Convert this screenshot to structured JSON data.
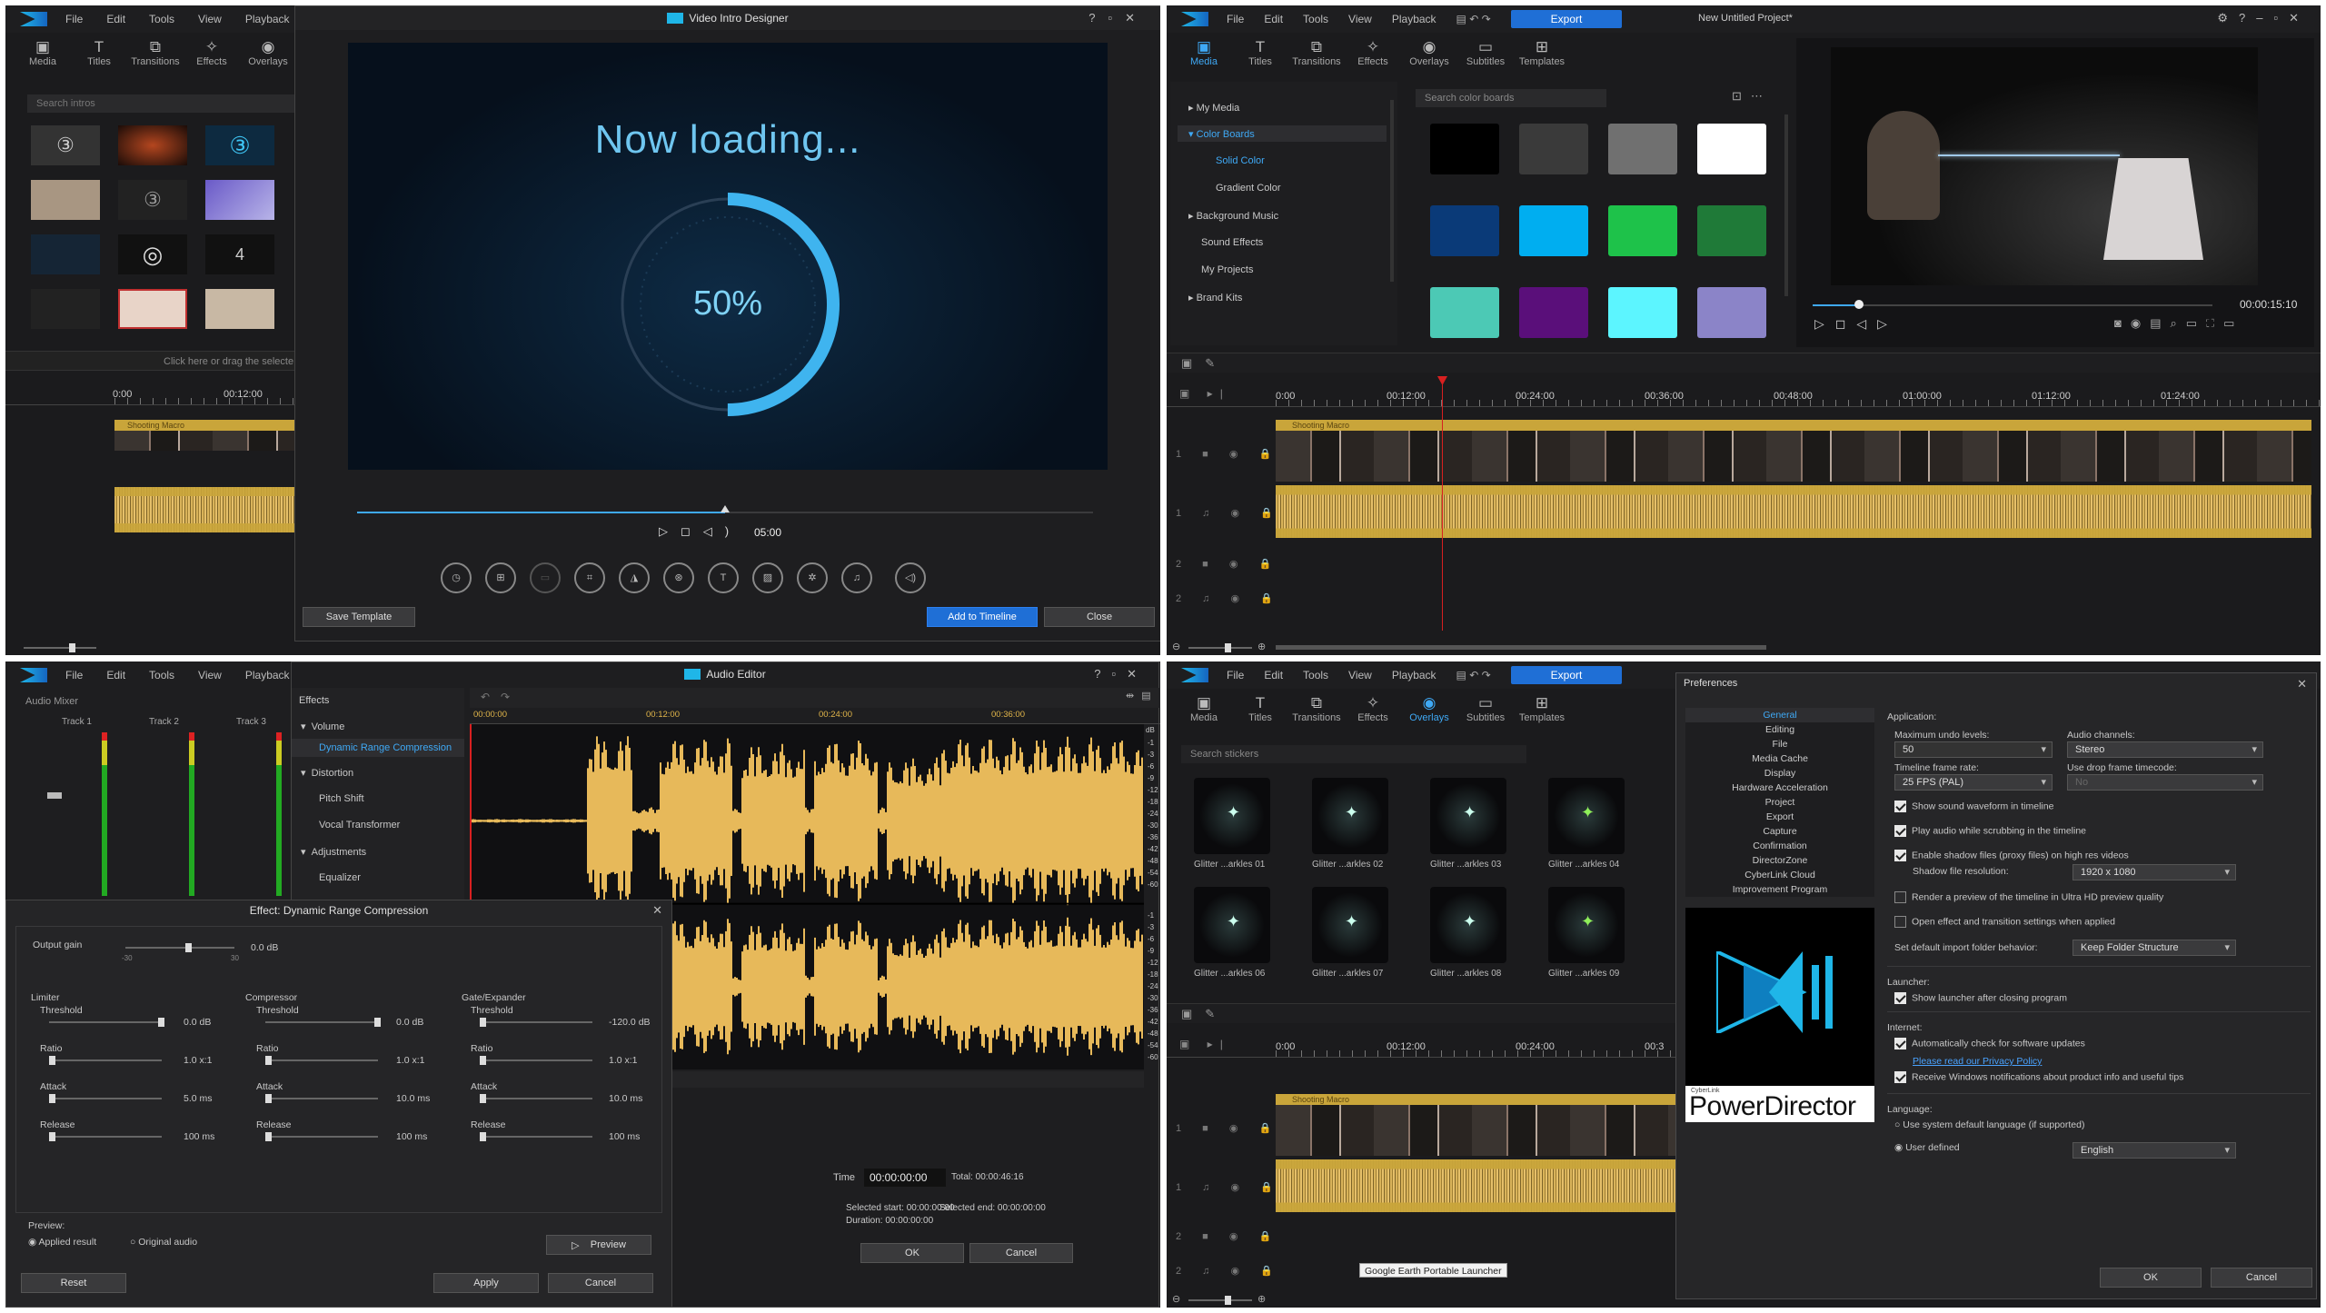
{
  "menu": {
    "file": "File",
    "edit": "Edit",
    "tools": "Tools",
    "view": "View",
    "playback": "Playback"
  },
  "toolbar": {
    "media": "Media",
    "titles": "Titles",
    "transitions": "Transitions",
    "effects": "Effects",
    "overlays": "Overlays",
    "subtitles": "Subtitles",
    "templates": "Templates"
  },
  "timeline": {
    "track_label": "Shooting Macro",
    "t0": "0:00",
    "t1": "00:12:00",
    "t2": "00:24:00",
    "t3": "00:36:00",
    "t4": "00:48:00",
    "t5": "01:00:00",
    "t6": "01:12:00",
    "t7": "01:24:00"
  },
  "q1": {
    "search_placeholder": "Search intros",
    "drop_hint": "Click here or drag the selecte",
    "dialog_title": "Video Intro Designer",
    "loading_text": "Now loading...",
    "progress_label": "50%",
    "progress_fraction": 0.5,
    "playback_fraction": 0.5,
    "time": "05:00",
    "save_template": "Save Template",
    "add_to_timeline": "Add to Timeline",
    "close": "Close"
  },
  "q2": {
    "export": "Export",
    "project_title": "New Untitled Project*",
    "search_placeholder": "Search color boards",
    "tree": {
      "my_media": "My Media",
      "color_boards": "Color Boards",
      "solid_color": "Solid Color",
      "gradient_color": "Gradient Color",
      "background_music": "Background Music",
      "sound_effects": "Sound Effects",
      "my_projects": "My Projects",
      "brand_kits": "Brand Kits"
    },
    "swatches": [
      "#000000",
      "#3a3a3a",
      "#707070",
      "#ffffff",
      "#0a3a78",
      "#00aef0",
      "#1ec24a",
      "#1f7a38",
      "#4cc9b5",
      "#5a0f7a",
      "#5cf5ff",
      "#8b84c8"
    ],
    "timecode": "00:00:15:10"
  },
  "q3": {
    "audio_mixer": "Audio Mixer",
    "tracks": [
      "Track 1",
      "Track 2",
      "Track 3"
    ],
    "dialog_title": "Audio Editor",
    "effects_header": "Effects",
    "volume": "Volume",
    "drc": "Dynamic Range Compression",
    "distortion": "Distortion",
    "pitch_shift": "Pitch Shift",
    "vocal_transformer": "Vocal Transformer",
    "adjustments": "Adjustments",
    "equalizer": "Equalizer",
    "ruler": [
      "00:00:00",
      "00:12:00",
      "00:24:00",
      "00:36:00"
    ],
    "db": "dB",
    "db_scale": [
      "-1",
      "-3",
      "-6",
      "-9",
      "-12",
      "-18",
      "-24",
      "-30",
      "-36",
      "-42",
      "-48",
      "-54",
      "-60"
    ],
    "time_label": "Time",
    "time_value": "00:00:00:00",
    "total": "Total: 00:00:46:16",
    "selected_start": "Selected start: 00:00:00:00",
    "selected_end": "Selected end: 00:00:00:00",
    "duration": "Duration: 00:00:00:00",
    "ok": "OK",
    "cancel": "Cancel",
    "effect_title": "Effect: Dynamic Range Compression",
    "output_gain": "Output gain",
    "output_gain_val": "0.0 dB",
    "limiter": "Limiter",
    "compressor": "Compressor",
    "gate": "Gate/Expander",
    "threshold": "Threshold",
    "ratio": "Ratio",
    "attack": "Attack",
    "release": "Release",
    "lim_th": "0.0 dB",
    "lim_ratio": "1.0 x:1",
    "lim_attack": "5.0 ms",
    "lim_release": "100 ms",
    "cmp_th": "0.0 dB",
    "cmp_ratio": "1.0 x:1",
    "cmp_attack": "10.0 ms",
    "cmp_release": "100 ms",
    "gate_th": "-120.0 dB",
    "gate_ratio": "1.0 x:1",
    "gate_attack": "10.0 ms",
    "gate_release": "100 ms",
    "preview_label": "Preview:",
    "applied_result": "Applied result",
    "original_audio": "Original audio",
    "preview_btn": "Preview",
    "reset": "Reset",
    "apply": "Apply"
  },
  "q4": {
    "export": "Export",
    "search_placeholder": "Search stickers",
    "stickers": [
      "Glitter ...arkles 01",
      "Glitter ...arkles 02",
      "Glitter ...arkles 03",
      "Glitter ...arkles 04",
      "Glitter ...arkles 06",
      "Glitter ...arkles 07",
      "Glitter ...arkles 08",
      "Glitter ...arkles 09"
    ],
    "tooltip": "Google Earth Portable Launcher",
    "pref_title": "Preferences",
    "pref_nav": [
      "General",
      "Editing",
      "File",
      "Media Cache",
      "Display",
      "Hardware Acceleration",
      "Project",
      "Export",
      "Capture",
      "Confirmation",
      "DirectorZone",
      "CyberLink Cloud",
      "Improvement Program"
    ],
    "application": "Application:",
    "max_undo": "Maximum undo levels:",
    "max_undo_val": "50",
    "audio_channels": "Audio channels:",
    "audio_channels_val": "Stereo",
    "frame_rate": "Timeline frame rate:",
    "frame_rate_val": "25 FPS (PAL)",
    "drop_frame": "Use drop frame timecode:",
    "drop_frame_val": "No",
    "opt1": "Show sound waveform in timeline",
    "opt2": "Play audio while scrubbing in the timeline",
    "opt3": "Enable shadow files (proxy files) on high res videos",
    "shadow_res": "Shadow file resolution:",
    "shadow_res_val": "1920 x 1080",
    "opt4": "Render a preview of the timeline in Ultra HD preview quality",
    "opt5": "Open effect and transition settings when applied",
    "import_folder": "Set default import folder behavior:",
    "import_folder_val": "Keep Folder Structure",
    "launcher": "Launcher:",
    "opt6": "Show launcher after closing program",
    "internet": "Internet:",
    "opt7": "Automatically check for software updates",
    "privacy": "Please read our Privacy Policy",
    "opt8": "Receive Windows notifications about product info and useful tips",
    "language": "Language:",
    "lang1": "Use system default language (if supported)",
    "lang2": "User defined",
    "lang_val": "English",
    "brand_small": "CyberLink",
    "brand": "PowerDirector",
    "ok": "OK",
    "cancel": "Cancel"
  }
}
